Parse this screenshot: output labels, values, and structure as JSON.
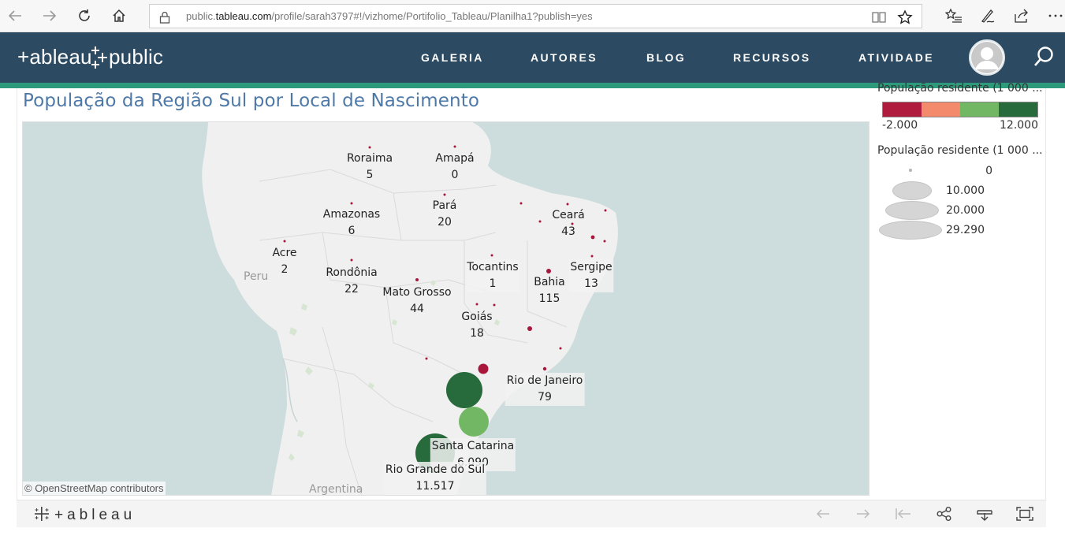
{
  "browser": {
    "url_host": "public.tableau.com",
    "url_prefix": "public.",
    "url_domain": "tableau.com",
    "url_path": "/profile/sarah3797#!/vizhome/Portifolio_Tableau/Planilha1?publish=yes"
  },
  "header": {
    "logo": "+ableau+public",
    "nav": [
      "GALERIA",
      "AUTORES",
      "BLOG",
      "RECURSOS",
      "ATIVIDADE"
    ]
  },
  "viz": {
    "title": "População da Região Sul por Local de Nascimento",
    "osm_credit": "© OpenStreetMap contributors",
    "countries": [
      "Peru",
      "Argentina"
    ],
    "states": [
      {
        "name": "Roraima",
        "value": "5"
      },
      {
        "name": "Amapá",
        "value": "0"
      },
      {
        "name": "Amazonas",
        "value": "6"
      },
      {
        "name": "Pará",
        "value": "20"
      },
      {
        "name": "Ceará",
        "value": "43"
      },
      {
        "name": "Acre",
        "value": "2"
      },
      {
        "name": "Rondônia",
        "value": "22"
      },
      {
        "name": "Tocantins",
        "value": "1"
      },
      {
        "name": "Sergipe",
        "value": "13"
      },
      {
        "name": "Bahia",
        "value": "115"
      },
      {
        "name": "Mato Grosso",
        "value": "44"
      },
      {
        "name": "Goiás",
        "value": "18"
      },
      {
        "name": "Rio de Janeiro",
        "value": "79"
      },
      {
        "name": "Santa Catarina",
        "value": "6.090"
      },
      {
        "name": "Rio Grande do Sul",
        "value": "11.517"
      }
    ]
  },
  "legend_color": {
    "title": "População residente (1 000 ...",
    "min": "-2.000",
    "max": "12.000",
    "colors": [
      "#b01c3e",
      "#f38a6b",
      "#72b864",
      "#276a3c"
    ]
  },
  "legend_size": {
    "title": "População residente (1 000 ...",
    "values": [
      "0",
      "10.000",
      "20.000",
      "29.290"
    ]
  },
  "toolbar": {
    "logo": "+ableau"
  },
  "colors": {
    "header_bg": "#2c4a62",
    "stripe": "#2e9a7c",
    "title": "#4e79a7",
    "dot_red": "#a8163c",
    "bubble_dark": "#276a3c",
    "bubble_light": "#72b864"
  }
}
